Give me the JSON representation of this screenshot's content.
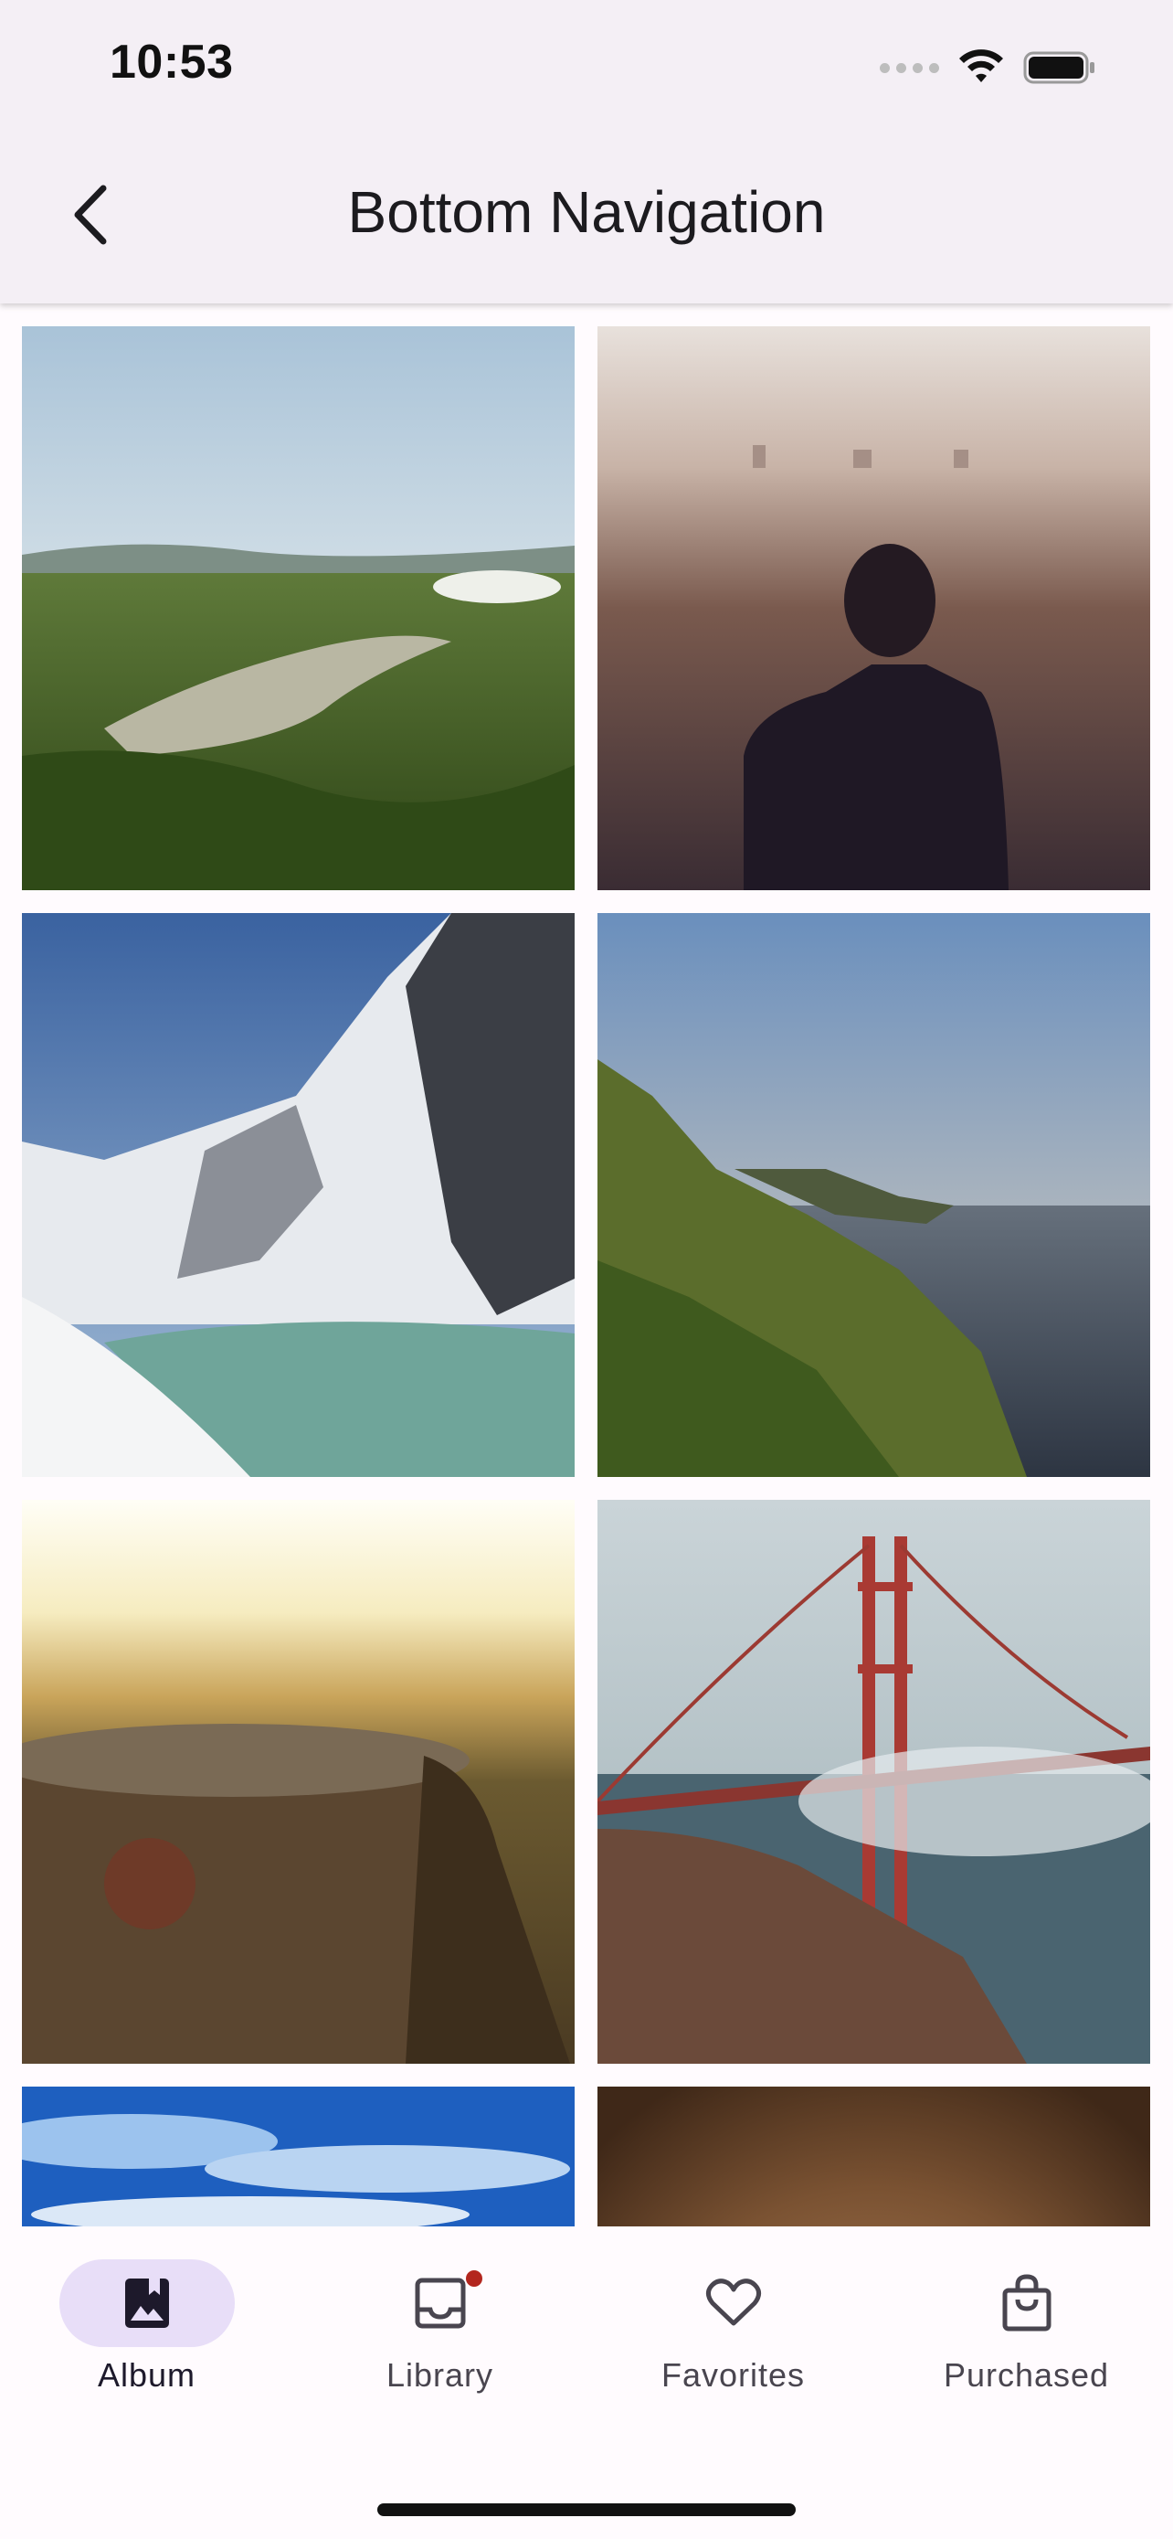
{
  "status_bar": {
    "time": "10:53"
  },
  "app_bar": {
    "title": "Bottom Navigation",
    "back_icon": "chevron-left-icon"
  },
  "photos": [
    {
      "name": "forest-lake-photo"
    },
    {
      "name": "woman-cityscape-photo"
    },
    {
      "name": "snowy-mountain-lake-photo"
    },
    {
      "name": "coastal-cliff-photo"
    },
    {
      "name": "tree-stump-sunset-photo"
    },
    {
      "name": "golden-gate-bridge-photo"
    },
    {
      "name": "blue-sky-clouds-photo"
    },
    {
      "name": "brown-blur-photo"
    }
  ],
  "bottom_nav": {
    "items": [
      {
        "label": "Album",
        "icon": "photo-album-icon",
        "active": true,
        "badge": false
      },
      {
        "label": "Library",
        "icon": "inbox-icon",
        "active": false,
        "badge": true
      },
      {
        "label": "Favorites",
        "icon": "heart-icon",
        "active": false,
        "badge": false
      },
      {
        "label": "Purchased",
        "icon": "shopping-bag-icon",
        "active": false,
        "badge": false
      }
    ]
  },
  "colors": {
    "app_bar_bg": "#f4eff5",
    "active_pill": "#e8def8",
    "badge": "#b3261e",
    "text": "#1c1b1f"
  }
}
